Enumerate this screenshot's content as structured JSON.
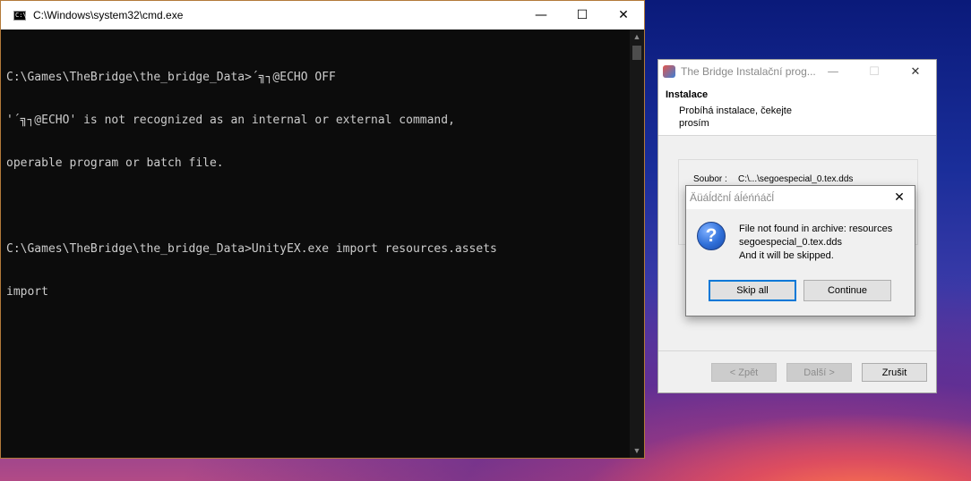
{
  "cmd": {
    "title": "C:\\Windows\\system32\\cmd.exe",
    "icon_label": "C:\\",
    "controls": {
      "minimize": "—",
      "maximize": "☐",
      "close": "✕"
    },
    "lines": [
      "C:\\Games\\TheBridge\\the_bridge_Data>´╗┐@ECHO OFF",
      "'´╗┐@ECHO' is not recognized as an internal or external command,",
      "operable program or batch file.",
      "",
      "C:\\Games\\TheBridge\\the_bridge_Data>UnityEX.exe import resources.assets",
      "import"
    ]
  },
  "installer": {
    "title": "The Bridge Instalační prog...",
    "controls": {
      "minimize": "—",
      "maximize": "☐",
      "close": "✕"
    },
    "header_title": "Instalace",
    "header_subtitle": "Probíhá instalace, čekejte prosím",
    "file_label": "Soubor :",
    "file_value": "C:\\...\\segoespecial_0.tex.dds",
    "buttons": {
      "back": "< Zpět",
      "next": "Další >",
      "cancel": "Zrušit"
    }
  },
  "dialog": {
    "title": "Äüáĺdčnĺ áĺéńńáčĺ",
    "close": "✕",
    "icon": "?",
    "message_lines": [
      "File not found in archive: resources",
      "segoespecial_0.tex.dds",
      "And it will be skipped."
    ],
    "buttons": {
      "skip_all": "Skip all",
      "continue": "Continue"
    }
  }
}
